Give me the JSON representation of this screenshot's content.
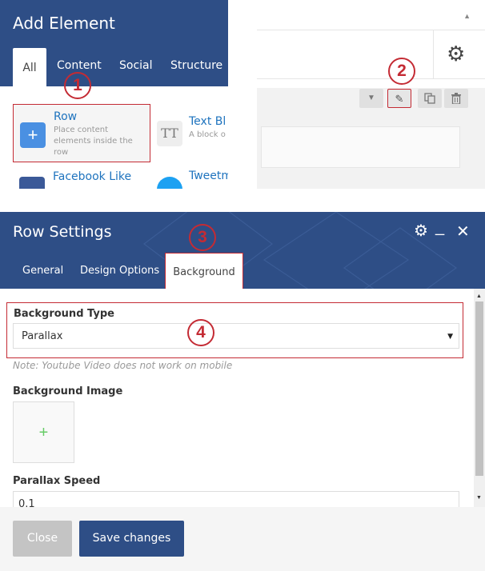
{
  "add_element": {
    "title": "Add Element",
    "tabs": [
      "All",
      "Content",
      "Social",
      "Structure"
    ],
    "elements": [
      {
        "name": "Row",
        "description": "Place content elements inside the row",
        "icon": "plus-icon",
        "icon_glyph": "+"
      },
      {
        "name": "Text Bl",
        "description": "A block o WYSIWYG",
        "icon": "text-icon",
        "icon_glyph": "TT"
      },
      {
        "name": "Facebook Like",
        "description": "",
        "icon": "facebook-icon"
      },
      {
        "name": "Tweetm Button",
        "description": "",
        "icon": "twitter-icon"
      }
    ]
  },
  "row_controls": {
    "icons": [
      "chevron-down-icon",
      "pencil-icon",
      "clone-icon",
      "trash-icon"
    ],
    "gear_icon": "gear-icon"
  },
  "row_settings": {
    "title": "Row Settings",
    "tabs": [
      "General",
      "Design Options",
      "Background"
    ],
    "active_tab": "Background",
    "fields": {
      "background_type": {
        "label": "Background Type",
        "value": "Parallax"
      },
      "note": "Note: Youtube Video does not work on mobile",
      "background_image": {
        "label": "Background Image",
        "add_glyph": "+"
      },
      "parallax_speed": {
        "label": "Parallax Speed",
        "value": "0.1"
      }
    },
    "buttons": {
      "close": "Close",
      "save": "Save changes"
    }
  },
  "badges": [
    "1",
    "2",
    "3",
    "4"
  ],
  "colors": {
    "header_blue": "#2e4e86",
    "highlight_red": "#c42b34",
    "link_blue": "#1e73be",
    "plus_green": "#66cc66"
  }
}
